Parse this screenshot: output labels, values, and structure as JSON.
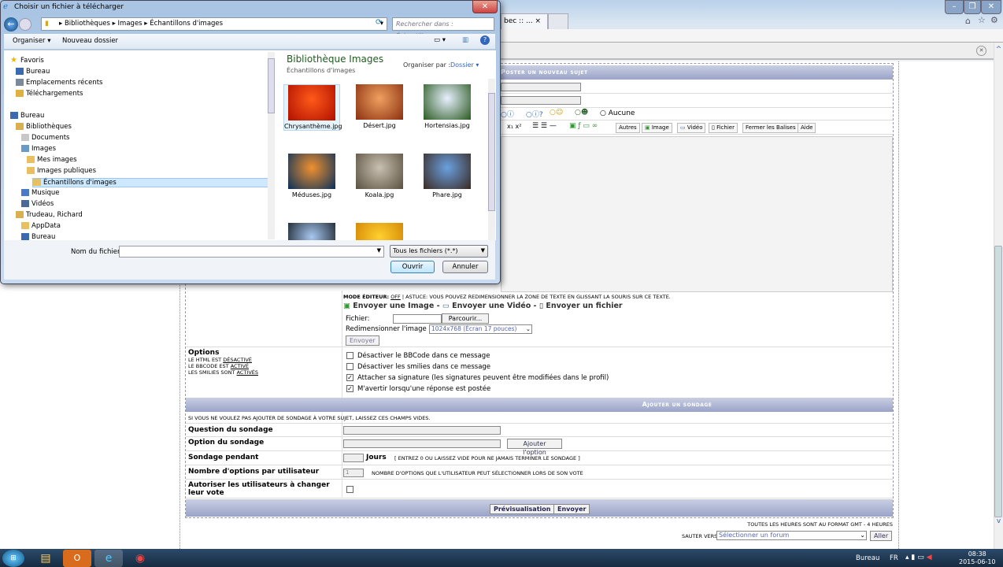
{
  "browser": {
    "tab_label": "bec :: ...",
    "tab_close": "×",
    "window_buttons": [
      "–",
      "❐",
      "✕"
    ],
    "notification_close": "✕",
    "scroll_up": "^",
    "scroll_down": "v"
  },
  "forum": {
    "post_header": "Poster un nouveau sujet",
    "icon_none_label": "Aucune",
    "toolbar": [
      "Autres",
      "Image",
      "Vidéo",
      "Fichier",
      "Fermer les Balises",
      "Aide"
    ],
    "editor_mode_prefix": "Mode éditeur:",
    "editor_mode_value": "Off",
    "editor_tip": "| Astuce: Vous pouvez redimensionner la zone de texte en glissant la souris sur ce texte.",
    "upload_image": "Envoyer une Image",
    "upload_video": "Envoyer une Vidéo",
    "upload_file": "Envoyer un fichier",
    "sep": "-",
    "file_label": "Fichier:",
    "browse_button": "Parcourir...",
    "resize_label": "Redimensionner l'image ?",
    "resize_value": "1024x768 (Écran 17 pouces)",
    "send_upload_button": "Envoyer",
    "options_title": "Options",
    "options_status": [
      {
        "prefix": "Le HTML est",
        "value": "Désactivé"
      },
      {
        "prefix": "Le BBCode est",
        "value": "Activé"
      },
      {
        "prefix": "Les smilies sont",
        "value": "Activés"
      }
    ],
    "options": [
      {
        "label": "Désactiver le BBCode dans ce message",
        "checked": false
      },
      {
        "label": "Désactiver les smilies dans ce message",
        "checked": false
      },
      {
        "label": "Attacher sa signature (les signatures peuvent être modifiées dans le profil)",
        "checked": true
      },
      {
        "label": "M'avertir lorsqu'une réponse est postée",
        "checked": true
      }
    ],
    "poll_header": "Ajouter un sondage",
    "poll_hint": "Si vous ne voulez pas ajouter de sondage à votre sujet, laissez ces champs vides.",
    "poll_question": "Question du sondage",
    "poll_option": "Option du sondage",
    "add_option_button": "Ajouter l'option",
    "poll_duration": "Sondage pendant",
    "days": "Jours",
    "days_hint": "[ Entrez 0 ou laissez vide pour ne jamais terminer le sondage ]",
    "options_per_user": "Nombre d'options par utilisateur",
    "options_per_user_value": "1",
    "options_per_user_hint": "Nombre d'options que l'utilisateur peut sélectionner lors de son vote",
    "allow_change": "Autoriser les utilisateurs à changer leur vote",
    "preview_button": "Prévisualisation",
    "submit_button": "Envoyer",
    "timezone": "Toutes les heures sont au format GMT - 4 Heures",
    "jump_label": "Sauter vers:",
    "jump_value": "Sélectionner un forum",
    "go_button": "Aller"
  },
  "dialog": {
    "title": "Choisir un fichier à télécharger",
    "close": "✕",
    "breadcrumb": [
      "Bibliothèques",
      "Images",
      "Échantillons d'images"
    ],
    "search_placeholder": "Rechercher dans : Échantillons...",
    "organize": "Organiser ▾",
    "new_folder": "Nouveau dossier",
    "nav": [
      {
        "label": "Favoris",
        "level": 0,
        "icon": "star",
        "color": "#f0b400"
      },
      {
        "label": "Bureau",
        "level": 1,
        "icon": "desktop",
        "color": "#3a6ab0"
      },
      {
        "label": "Emplacements récents",
        "level": 1,
        "icon": "recent",
        "color": "#7a8a9a"
      },
      {
        "label": "Téléchargements",
        "level": 1,
        "icon": "download",
        "color": "#e0b040"
      },
      {
        "label": "Bureau",
        "level": 0,
        "icon": "desktop",
        "color": "#3a6ab0"
      },
      {
        "label": "Bibliothèques",
        "level": 1,
        "icon": "library",
        "color": "#d8b050"
      },
      {
        "label": "Documents",
        "level": 2,
        "icon": "document",
        "color": "#c8c8c8"
      },
      {
        "label": "Images",
        "level": 2,
        "icon": "images",
        "color": "#6a9ac8"
      },
      {
        "label": "Mes images",
        "level": 3,
        "icon": "folder",
        "color": "#e8c060"
      },
      {
        "label": "Images publiques",
        "level": 3,
        "icon": "folder",
        "color": "#e8c060"
      },
      {
        "label": "Échantillons d'images",
        "level": 4,
        "icon": "folder",
        "color": "#e8c060",
        "selected": true
      },
      {
        "label": "Musique",
        "level": 2,
        "icon": "music",
        "color": "#4a7ac8"
      },
      {
        "label": "Vidéos",
        "level": 2,
        "icon": "video",
        "color": "#4a6a9a"
      },
      {
        "label": "Trudeau, Richard",
        "level": 1,
        "icon": "user",
        "color": "#d8b050"
      },
      {
        "label": "AppData",
        "level": 2,
        "icon": "folder",
        "color": "#e8c060"
      },
      {
        "label": "Bureau",
        "level": 2,
        "icon": "desktop",
        "color": "#3a6ab0"
      }
    ],
    "library_title": "Bibliothèque Images",
    "library_subtitle": "Échantillons d'images",
    "arrange_label": "Organiser par :",
    "arrange_value": "Dossier ▾",
    "files": [
      {
        "name": "Chrysanthème.jpg",
        "c1": "#ff5a1a",
        "c2": "#b01000"
      },
      {
        "name": "Désert.jpg",
        "c1": "#f0a060",
        "c2": "#8a3010"
      },
      {
        "name": "Hortensias.jpg",
        "c1": "#e8f0ff",
        "c2": "#2a5a20"
      },
      {
        "name": "Méduses.jpg",
        "c1": "#f09030",
        "c2": "#08305a"
      },
      {
        "name": "Koala.jpg",
        "c1": "#c8c0b0",
        "c2": "#5a5040"
      },
      {
        "name": "Phare.jpg",
        "c1": "#6aa0e0",
        "c2": "#3a2a20"
      },
      {
        "name": "",
        "c1": "#a8c8f0",
        "c2": "#101820"
      },
      {
        "name": "",
        "c1": "#ffd030",
        "c2": "#d08000"
      }
    ],
    "filename_label": "Nom du fichier :",
    "filename_value": "",
    "filter_value": "Tous les fichiers (*.*)",
    "open_button": "Ouvrir",
    "cancel_button": "Annuler"
  },
  "taskbar": {
    "toolbar_label": "Bureau",
    "lang": "FR",
    "time": "08:38",
    "date": "2015-06-10"
  }
}
